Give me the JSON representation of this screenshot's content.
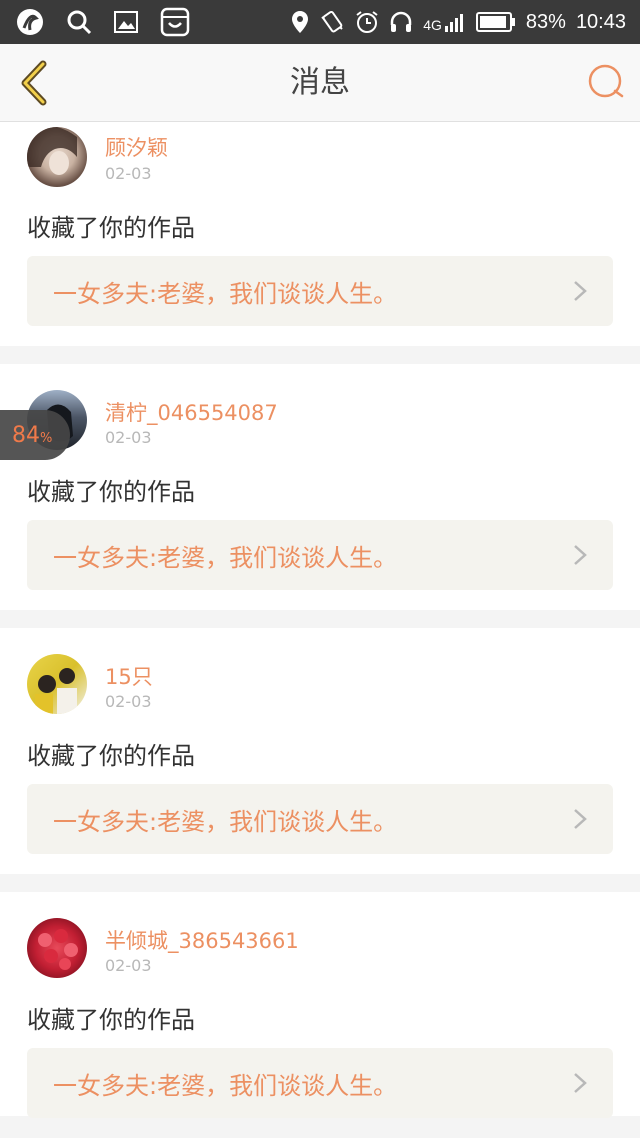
{
  "status_bar": {
    "battery": "83%",
    "time": "10:43",
    "network": "4G"
  },
  "nav": {
    "title": "消息"
  },
  "messages": [
    {
      "user": "顾汐颖",
      "date": "02-03",
      "action": "收藏了你的作品",
      "work": "一女多夫:老婆，我们谈谈人生。"
    },
    {
      "user": "清柠_046554087",
      "date": "02-03",
      "action": "收藏了你的作品",
      "work": "一女多夫:老婆，我们谈谈人生。"
    },
    {
      "user": "15只",
      "date": "02-03",
      "action": "收藏了你的作品",
      "work": "一女多夫:老婆，我们谈谈人生。"
    },
    {
      "user": "半倾城_386543661",
      "date": "02-03",
      "action": "收藏了你的作品",
      "work": "一女多夫:老婆，我们谈谈人生。"
    }
  ],
  "floating_badge": {
    "value": "84",
    "unit": "%"
  },
  "colors": {
    "accent": "#ec9062",
    "status_bar_bg": "#3a3a3a",
    "link_bg": "#f4f3ee"
  }
}
